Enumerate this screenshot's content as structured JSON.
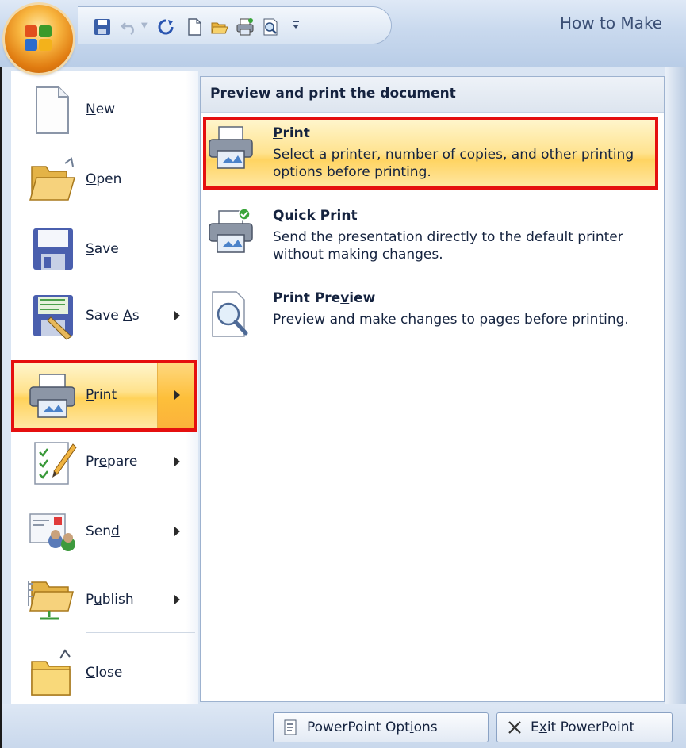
{
  "window": {
    "title": "How to Make"
  },
  "office_menu": {
    "items": [
      {
        "label_pre": "",
        "label_u": "N",
        "label_post": "ew",
        "has_submenu": false
      },
      {
        "label_pre": "",
        "label_u": "O",
        "label_post": "pen",
        "has_submenu": false
      },
      {
        "label_pre": "",
        "label_u": "S",
        "label_post": "ave",
        "has_submenu": false
      },
      {
        "label_pre": "Save ",
        "label_u": "A",
        "label_post": "s",
        "has_submenu": true
      },
      {
        "label_pre": "",
        "label_u": "P",
        "label_post": "rint",
        "has_submenu": true,
        "selected": true
      },
      {
        "label_pre": "Pr",
        "label_u": "e",
        "label_post": "pare",
        "has_submenu": true
      },
      {
        "label_pre": "Sen",
        "label_u": "d",
        "label_post": "",
        "has_submenu": true
      },
      {
        "label_pre": "P",
        "label_u": "u",
        "label_post": "blish",
        "has_submenu": true
      },
      {
        "label_pre": "",
        "label_u": "C",
        "label_post": "lose",
        "has_submenu": false
      }
    ]
  },
  "submenu": {
    "header": "Preview and print the document",
    "items": [
      {
        "title_pre": "",
        "title_u": "P",
        "title_post": "rint",
        "description": "Select a printer, number of copies, and other printing options before printing.",
        "selected": true
      },
      {
        "title_pre": "",
        "title_u": "Q",
        "title_post": "uick Print",
        "description": "Send the presentation directly to the default printer without making changes."
      },
      {
        "title_pre": "Print Pre",
        "title_u": "v",
        "title_post": "iew",
        "description": "Preview and make changes to pages before printing."
      }
    ]
  },
  "bottom_buttons": {
    "options_pre": "PowerPoint Opt",
    "options_u": "i",
    "options_post": "ons",
    "exit_pre": "E",
    "exit_u": "x",
    "exit_post": "it PowerPoint"
  },
  "colors": {
    "highlight_border": "#e50f0f",
    "hover_gold": "#ffd25a",
    "text": "#15233f"
  },
  "icons": [
    "office-logo-icon",
    "save-icon",
    "undo-icon",
    "redo-icon",
    "new-document-icon",
    "open-folder-icon",
    "quick-print-icon",
    "print-preview-icon",
    "customize-qat-icon"
  ]
}
